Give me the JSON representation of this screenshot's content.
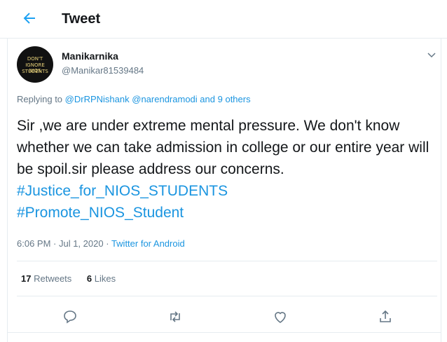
{
  "header": {
    "title": "Tweet"
  },
  "user": {
    "name": "Manikarnika",
    "handle": "@Manikar81539484",
    "avatar_text": [
      "DON'T",
      "IGNORE NIOS",
      "STUDENTS"
    ]
  },
  "reply": {
    "prefix": "Replying to",
    "mention1": "@DrRPNishank",
    "mention2": "@narendramodi",
    "and_word": "and",
    "others": "9 others"
  },
  "tweet": {
    "text": "Sir ,we are under extreme mental pressure. We don't know whether we can take admission in college or our entire year will be spoil.sir please address our concerns.",
    "hashtags": [
      "#Justice_for_NIOS_STUDENTS",
      "#Promote_NIOS_Student"
    ]
  },
  "meta": {
    "time": "6:06 PM · Jul 1, 2020",
    "separator": "·",
    "source": "Twitter for Android"
  },
  "stats": {
    "retweets_count": "17",
    "retweets_label": "Retweets",
    "likes_count": "6",
    "likes_label": "Likes"
  },
  "icons": {
    "back": "back-arrow-icon",
    "caret": "chevron-down-icon",
    "reply": "reply-icon",
    "retweet": "retweet-icon",
    "like": "heart-icon",
    "share": "share-icon"
  },
  "colors": {
    "accent": "#1da1f2",
    "link": "#1b95e0",
    "muted": "#657786",
    "border": "#e6ecf0"
  }
}
